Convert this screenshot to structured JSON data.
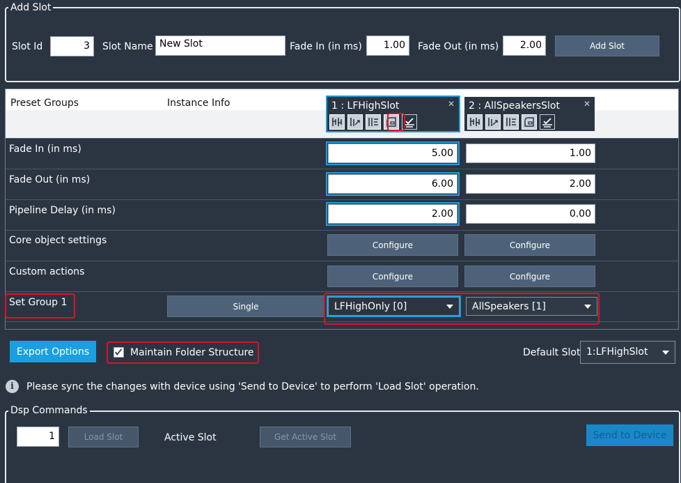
{
  "add_slot": {
    "legend": "Add Slot",
    "slot_id_label": "Slot Id",
    "slot_id_value": "3",
    "slot_name_label": "Slot Name",
    "slot_name_value": "New Slot",
    "fade_in_label": "Fade In (in ms)",
    "fade_in_value": "1.00",
    "fade_out_label": "Fade Out (in ms)",
    "fade_out_value": "2.00",
    "add_button": "Add Slot"
  },
  "grid": {
    "header": {
      "preset_groups": "Preset Groups",
      "instance_info": "Instance Info"
    },
    "instances": [
      {
        "title": "1 : LFHighSlot",
        "close": "✕"
      },
      {
        "title": "2 : AllSpeakersSlot",
        "close": "✕"
      }
    ],
    "rows": {
      "fade_in": {
        "label": "Fade In (in ms)",
        "values": [
          "5.00",
          "1.00"
        ]
      },
      "fade_out": {
        "label": "Fade Out (in ms)",
        "values": [
          "6.00",
          "2.00"
        ]
      },
      "pipeline_delay": {
        "label": "Pipeline Delay (in ms)",
        "values": [
          "2.00",
          "0.00"
        ]
      },
      "core_object": {
        "label": "Core object settings",
        "buttons": [
          "Configure",
          "Configure"
        ]
      },
      "custom_actions": {
        "label": "Custom actions",
        "buttons": [
          "Configure",
          "Configure"
        ]
      },
      "set_group": {
        "label": "Set Group 1",
        "mode_button": "Single",
        "selects": [
          "LFHighOnly [0]",
          "AllSpeakers [1]"
        ]
      }
    }
  },
  "export": {
    "button": "Export Options",
    "maintain_label": "Maintain Folder Structure",
    "maintain_checked": true,
    "default_slot_label": "Default Slot",
    "default_slot_value": "1:LFHighSlot"
  },
  "info": {
    "icon": "info-icon",
    "message": "Please sync the changes with device using 'Send to Device' to perform 'Load Slot' operation."
  },
  "dsp": {
    "legend": "Dsp Commands",
    "slot_value": "1",
    "load_slot": "Load Slot",
    "active_slot_label": "Active Slot",
    "get_active_slot": "Get Active Slot",
    "send_to_device": "Send to Device"
  },
  "colors": {
    "background": "#2b3542",
    "accent": "#1aa0e0",
    "highlight_red": "#e0102a"
  }
}
